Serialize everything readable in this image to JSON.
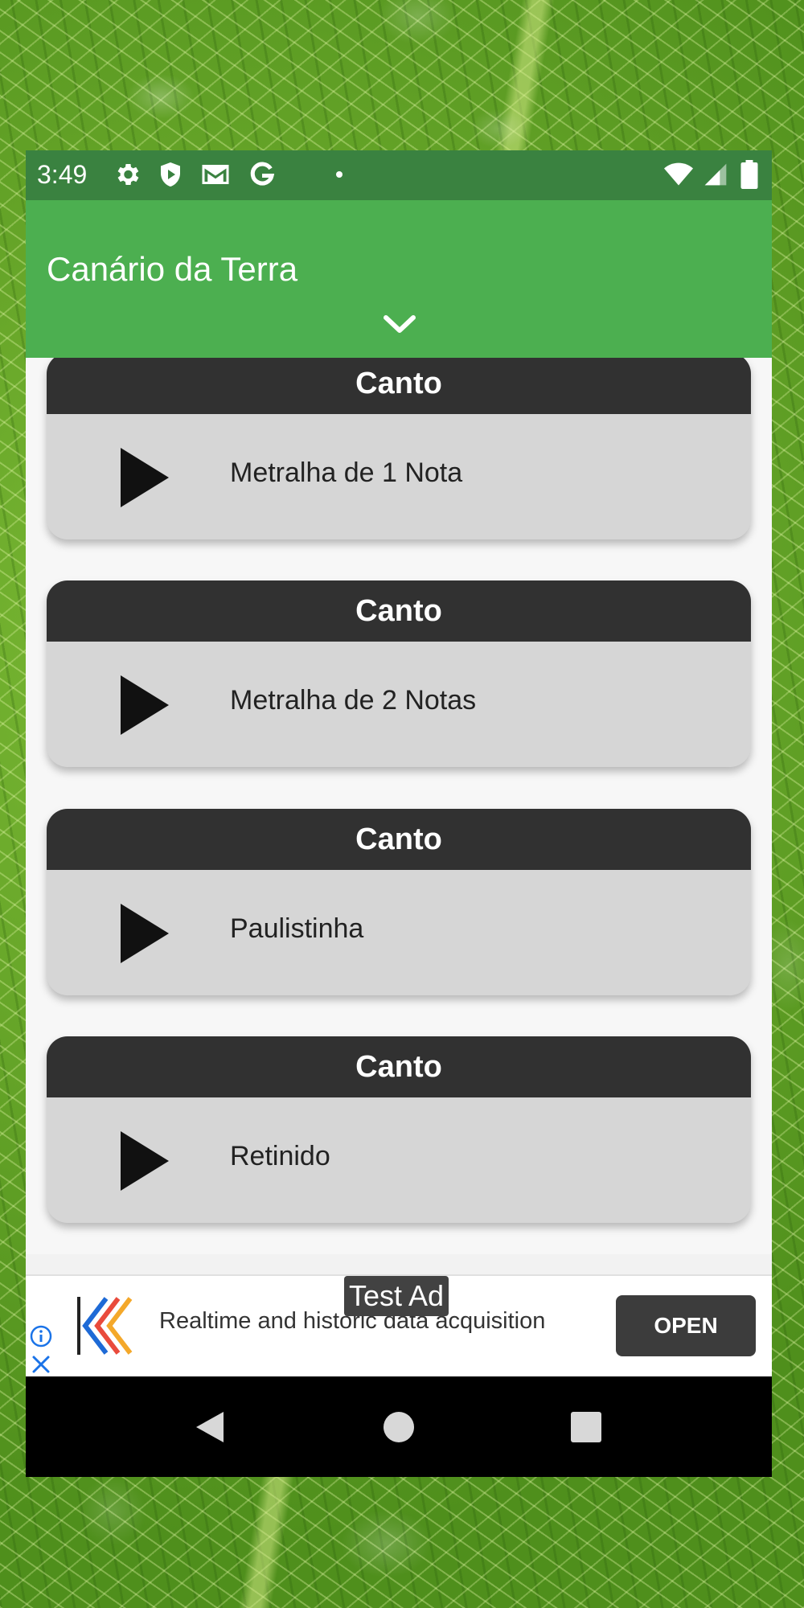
{
  "status_bar": {
    "time": "3:49",
    "icons": [
      "gear-icon",
      "shield-play-icon",
      "gmail-icon",
      "google-icon",
      "dot-icon",
      "wifi-icon",
      "signal-icon",
      "battery-icon"
    ]
  },
  "app_bar": {
    "title": "Canário da Terra",
    "expand_icon": "chevron-down-icon"
  },
  "cards": [
    {
      "header": "Canto",
      "label": "Metralha de 1 Nota"
    },
    {
      "header": "Canto",
      "label": "Metralha de 2 Notas"
    },
    {
      "header": "Canto",
      "label": "Paulistinha"
    },
    {
      "header": "Canto",
      "label": "Retinido"
    }
  ],
  "ad": {
    "tag": "Test Ad",
    "text": "Realtime and historic data acquisition",
    "button": "OPEN"
  },
  "colors": {
    "status_bar": "#3a8240",
    "app_bar": "#4caf50",
    "card_header": "#313131",
    "card_body": "#d6d6d6"
  },
  "nav_bar": {
    "buttons": [
      "back-icon",
      "home-icon",
      "recents-icon"
    ]
  }
}
